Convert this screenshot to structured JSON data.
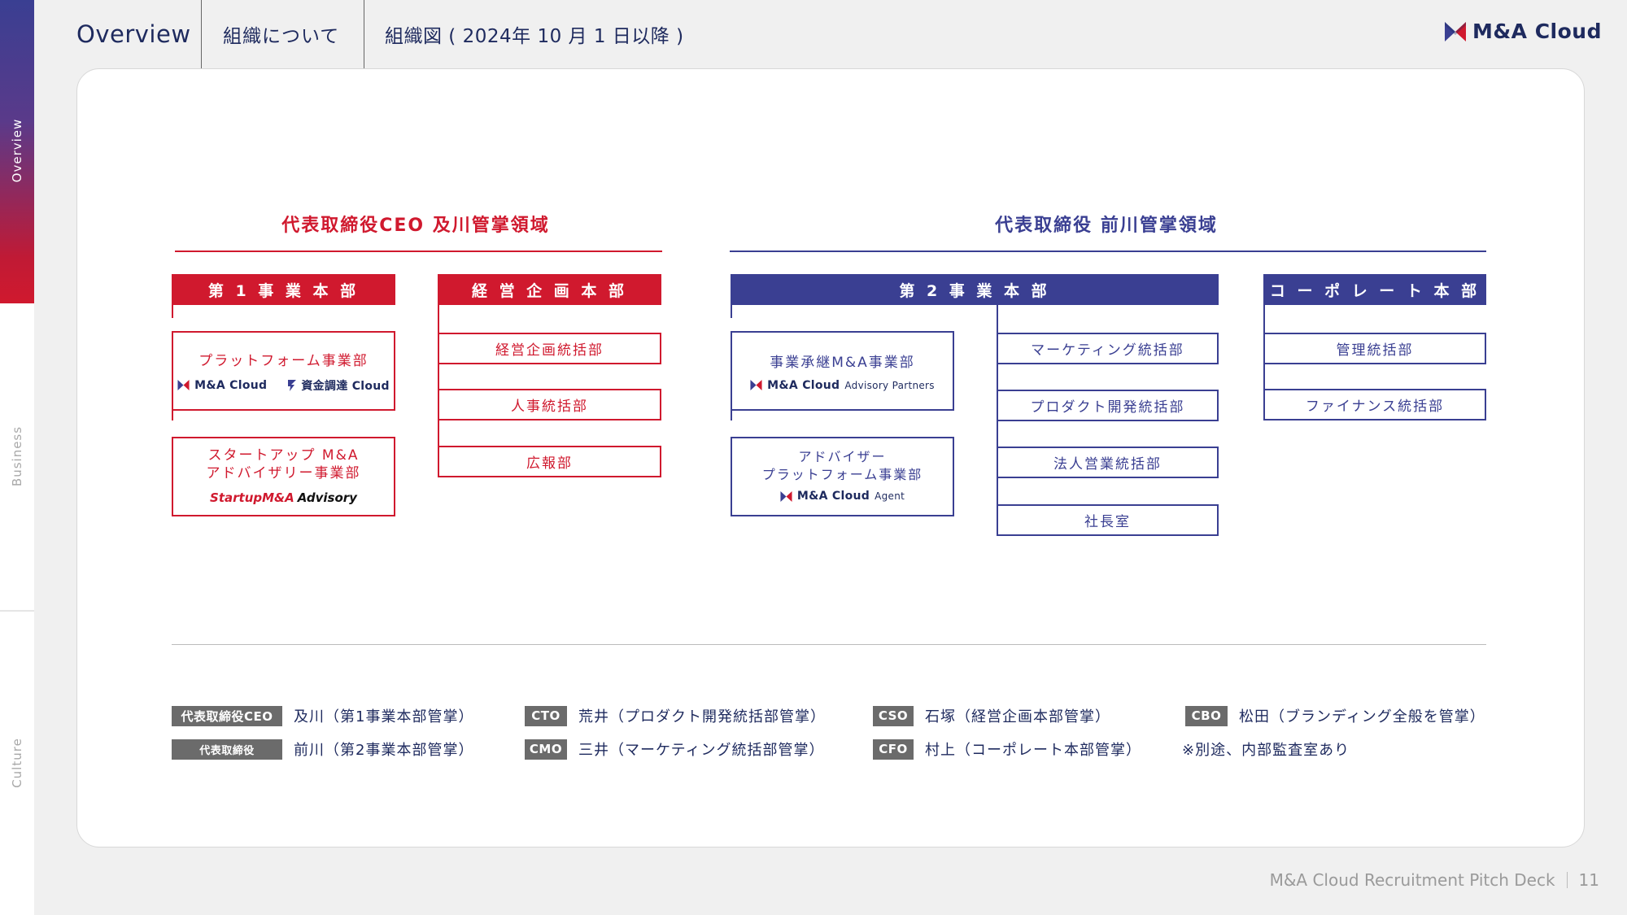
{
  "sidebar": {
    "sections": [
      {
        "label": "Overview",
        "active": true
      },
      {
        "label": "Business",
        "active": false
      },
      {
        "label": "Culture",
        "active": false
      }
    ]
  },
  "header": {
    "breadcrumbs": [
      "Overview",
      "組織について",
      "組織図 ( 2024年 10 月 1 日以降 )"
    ],
    "logo_text": "M&A Cloud"
  },
  "colors": {
    "red": "#d0192e",
    "navy": "#3a3f92",
    "badge": "#6b6b6b"
  },
  "org": {
    "left_domain_title": "代表取締役CEO 及川管掌領域",
    "right_domain_title": "代表取締役 前川管掌領域",
    "div1": {
      "title": "第 1 事 業 本 部",
      "units": [
        {
          "name": "プラットフォーム事業部",
          "brand1": "M&A Cloud",
          "brand2": "資金調達 Cloud"
        },
        {
          "name_line1": "スタートアップ M&A",
          "name_line2": "アドバイザリー事業部",
          "brand_red": "StartupM&A",
          "brand_black": "Advisory"
        }
      ]
    },
    "keiei": {
      "title": "経 営 企 画 本 部",
      "units": [
        "経営企画統括部",
        "人事統括部",
        "広報部"
      ]
    },
    "div2": {
      "title": "第 2 事 業 本 部",
      "left_units": [
        {
          "name": "事業承継M&A事業部",
          "brand": "M&A Cloud",
          "brand_sub": "Advisory Partners"
        },
        {
          "name_line1": "アドバイザー",
          "name_line2": "プラットフォーム事業部",
          "brand": "M&A Cloud",
          "brand_sub": "Agent"
        }
      ],
      "right_units": [
        "マーケティング統括部",
        "プロダクト開発統括部",
        "法人営業統括部",
        "社長室"
      ]
    },
    "corporate": {
      "title": "コ ー ポ レ ー ト 本 部",
      "units": [
        "管理統括部",
        "ファイナンス統括部"
      ]
    }
  },
  "roles": [
    {
      "badge": "代表取締役CEO",
      "text": "及川（第1事業本部管掌）"
    },
    {
      "badge": "代表取締役",
      "text": "前川（第2事業本部管掌）"
    },
    {
      "badge": "CTO",
      "text": "荒井（プロダクト開発統括部管掌）"
    },
    {
      "badge": "CMO",
      "text": "三井（マーケティング統括部管掌）"
    },
    {
      "badge": "CSO",
      "text": "石塚（経営企画本部管掌）"
    },
    {
      "badge": "CFO",
      "text": "村上（コーポレート本部管掌）"
    },
    {
      "badge": "CBO",
      "text": "松田（ブランディング全般を管掌）"
    }
  ],
  "note": "※別途、内部監査室あり",
  "footer": {
    "title": "M&A Cloud Recruitment Pitch Deck",
    "page": "11"
  }
}
